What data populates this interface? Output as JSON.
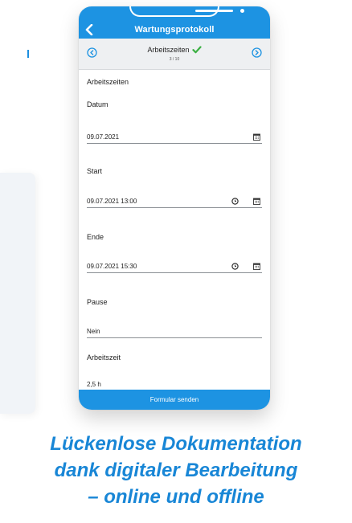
{
  "header": {
    "title": "Wartungsprotokoll"
  },
  "section": {
    "title": "Arbeitszeiten",
    "progress": "3 / 10"
  },
  "form": {
    "heading": "Arbeitszeiten",
    "fields": [
      {
        "label": "Datum",
        "value": "09.07.2021"
      },
      {
        "label": "Start",
        "value": "09.07.2021 13:00"
      },
      {
        "label": "Ende",
        "value": "09.07.2021 15:30"
      },
      {
        "label": "Pause",
        "value": "Nein"
      },
      {
        "label": "Arbeitszeit",
        "value": "2,5 h"
      }
    ]
  },
  "footer": {
    "submit_label": "Formular senden"
  },
  "caption": {
    "line1": "Lückenlose Dokumentation",
    "line2": "dank digitaler Bearbeitung",
    "line3": "– online und offline"
  },
  "colors": {
    "accent": "#1d93e2",
    "caption": "#1886d6",
    "check": "#3cb043"
  },
  "icons": [
    "back-icon",
    "chevron-left-circle-icon",
    "chevron-right-circle-icon",
    "check-icon",
    "calendar-icon",
    "clock-icon"
  ]
}
